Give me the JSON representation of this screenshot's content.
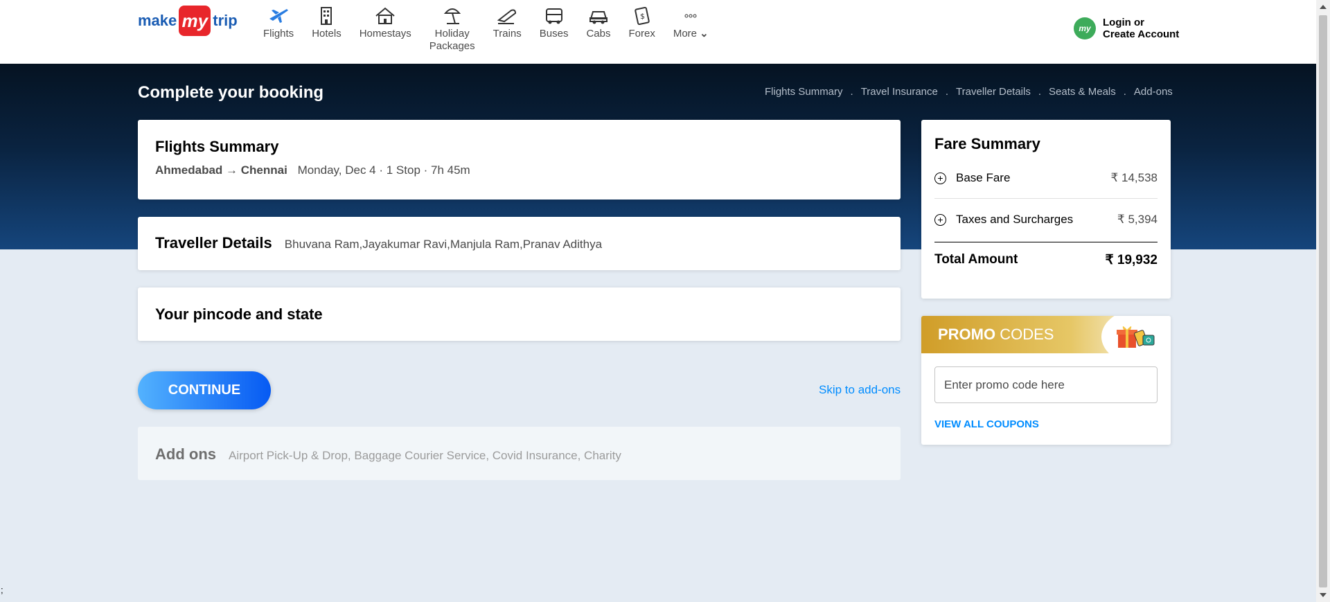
{
  "brand": {
    "make": "make",
    "my": "my",
    "trip": "trip"
  },
  "nav": [
    {
      "label": "Flights",
      "icon": "flight-icon"
    },
    {
      "label": "Hotels",
      "icon": "hotel-icon"
    },
    {
      "label": "Homestays",
      "icon": "homestay-icon"
    },
    {
      "label": "Holiday\nPackages",
      "icon": "holiday-icon"
    },
    {
      "label": "Trains",
      "icon": "train-icon"
    },
    {
      "label": "Buses",
      "icon": "bus-icon"
    },
    {
      "label": "Cabs",
      "icon": "cab-icon"
    },
    {
      "label": "Forex",
      "icon": "forex-icon"
    },
    {
      "label": "More",
      "icon": "more-icon"
    }
  ],
  "login": {
    "avatar": "my",
    "line1": "Login or",
    "line2": "Create Account"
  },
  "page": {
    "title": "Complete your booking",
    "steps": [
      "Flights Summary",
      "Travel Insurance",
      "Traveller Details",
      "Seats & Meals",
      "Add-ons"
    ],
    "step_separator": "."
  },
  "flights": {
    "title": "Flights Summary",
    "from": "Ahmedabad",
    "arrow": "→",
    "to": "Chennai",
    "meta": "Monday, Dec 4 · 1 Stop · 7h 45m"
  },
  "travellers": {
    "title": "Traveller Details",
    "names": "Bhuvana Ram,Jayakumar Ravi,Manjula Ram,Pranav Adithya"
  },
  "pincode": {
    "title": "Your pincode and state"
  },
  "actions": {
    "continue": "CONTINUE",
    "skip": "Skip to add-ons"
  },
  "addons": {
    "title": "Add ons",
    "list": "Airport Pick-Up & Drop, Baggage Courier Service, Covid Insurance, Charity"
  },
  "fare": {
    "title": "Fare Summary",
    "rows": [
      {
        "label": "Base Fare",
        "amount": "₹ 14,538"
      },
      {
        "label": "Taxes and Surcharges",
        "amount": "₹ 5,394"
      }
    ],
    "total_label": "Total Amount",
    "total_amount": "₹ 19,932"
  },
  "promo": {
    "title_bold": "PROMO",
    "title_rest": " CODES",
    "placeholder": "Enter promo code here",
    "view_all": "VIEW ALL COUPONS"
  },
  "stray_char": ";",
  "colors": {
    "brand_red": "#e8262b",
    "brand_blue": "#1a5cb3",
    "link_blue": "#008cff",
    "band_dark": "#051322",
    "band_light": "#15457c",
    "promo_gold": "#d09d28",
    "page_bg": "#e4ebf3"
  }
}
